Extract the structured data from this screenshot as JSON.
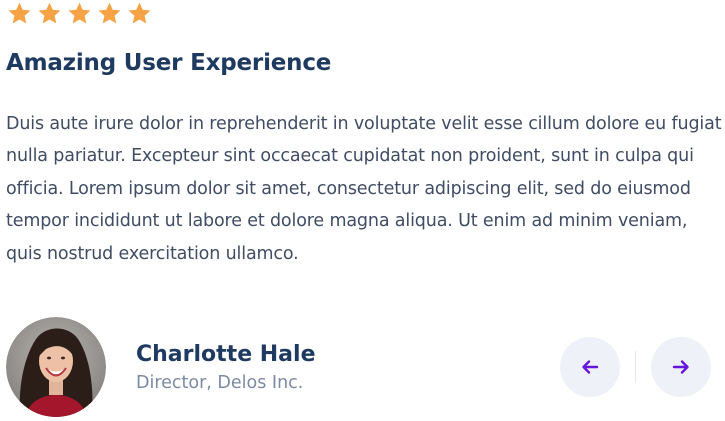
{
  "testimonial": {
    "rating": 5,
    "star_color": "#f6a346",
    "title": "Amazing User Experience",
    "body": "Duis aute irure dolor in reprehenderit in voluptate velit esse cillum dolore eu fugiat nulla pariatur. Excepteur sint occaecat cupidatat non proident, sunt in culpa qui officia. Lorem ipsum dolor sit amet, consectetur adipiscing elit, sed do eiusmod tempor incididunt ut labore et dolore magna aliqua. Ut enim ad minim veniam, quis nostrud exercitation ullamco.",
    "author": {
      "name": "Charlotte Hale",
      "role": "Director, Delos Inc."
    }
  },
  "navigation": {
    "prev_icon": "arrow-left-icon",
    "next_icon": "arrow-right-icon",
    "icon_color": "#6515dd"
  }
}
